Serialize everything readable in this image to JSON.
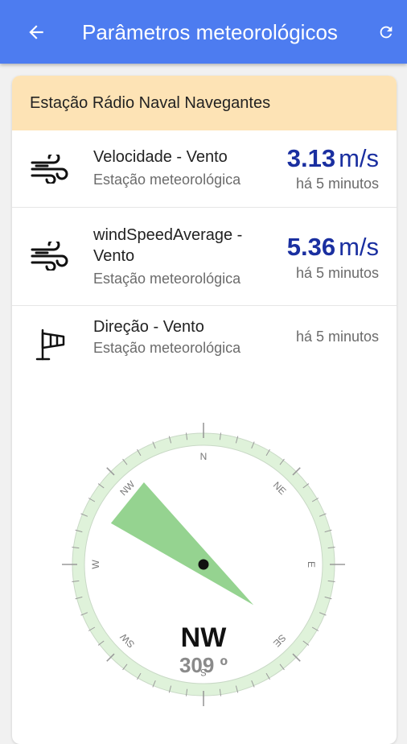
{
  "appbar": {
    "title": "Parâmetros meteorológicos",
    "back_icon": "arrow-left-icon",
    "refresh_icon": "refresh-icon",
    "background": "#4d7cf0"
  },
  "station": {
    "name": "Estação Rádio Naval Navegantes",
    "header_color": "#fde3b5"
  },
  "parameters": [
    {
      "icon": "wind-icon",
      "name": "Velocidade - Vento",
      "source": "Estação meteorológica",
      "value": "3.13",
      "unit": "m/s",
      "time": "há 5 minutos"
    },
    {
      "icon": "wind-icon",
      "name": "windSpeedAverage - Vento",
      "source": "Estação meteorológica",
      "value": "5.36",
      "unit": "m/s",
      "time": "há 5 minutos"
    },
    {
      "icon": "windsock-icon",
      "name": "Direção - Vento",
      "source": "Estação meteorológica",
      "time": "há 5 minutos"
    }
  ],
  "compass": {
    "cardinals": [
      "N",
      "NE",
      "E",
      "SE",
      "S",
      "SW",
      "W",
      "NW"
    ],
    "direction": "NW",
    "degrees_label": "309 º",
    "degrees": 309,
    "sector_color": "#8fd18a",
    "ring_color": "#dff2da"
  },
  "value_color": "#1a2fa0"
}
